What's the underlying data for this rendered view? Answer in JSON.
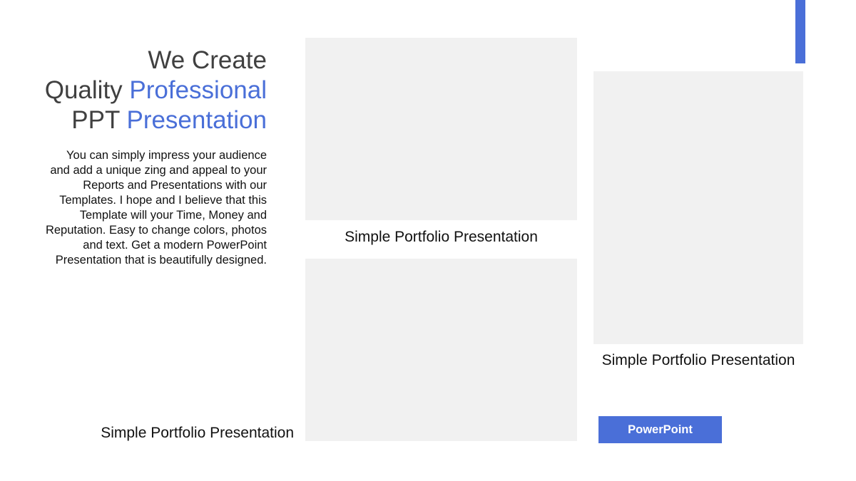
{
  "colors": {
    "accent": "#4a6fd8",
    "heading": "#404040",
    "placeholder": "#f1f1f1"
  },
  "headline": {
    "line1": "We Create",
    "line2_prefix": "Quality ",
    "line2_accent": "Professional",
    "line3_prefix": "PPT ",
    "line3_accent": "Presentation"
  },
  "body_text": "You can simply impress your audience and add a unique zing and appeal to your Reports and Presentations with our Templates. I hope and I believe that this Template will your Time, Money and Reputation. Easy to change colors, photos and text. Get a modern PowerPoint Presentation that is beautifully designed.",
  "captions": {
    "top_center": "Simple Portfolio Presentation",
    "right": "Simple Portfolio Presentation",
    "bottom_left": "Simple Portfolio Presentation"
  },
  "button": {
    "label": "PowerPoint"
  }
}
